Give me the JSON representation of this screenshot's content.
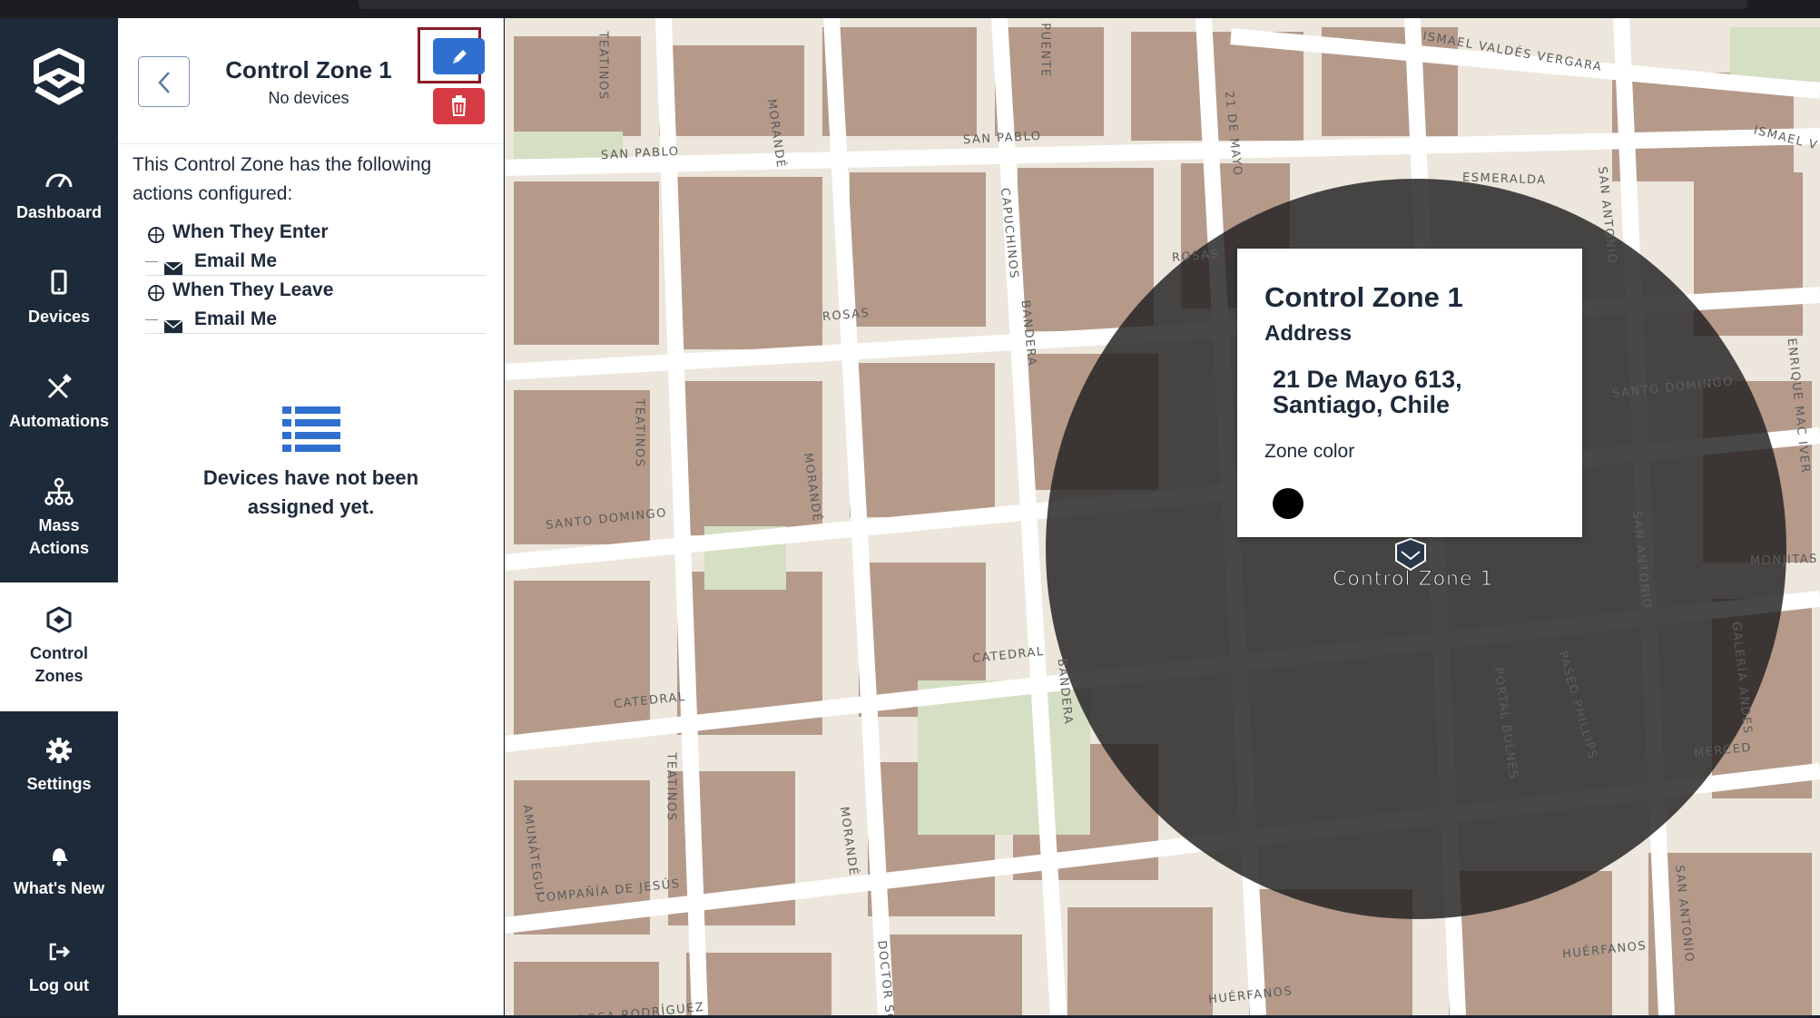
{
  "sidebar": {
    "items": [
      {
        "label": "Dashboard",
        "icon": "gauge-icon"
      },
      {
        "label": "Devices",
        "icon": "device-icon"
      },
      {
        "label": "Automations",
        "icon": "tools-icon"
      },
      {
        "label": "Mass Actions",
        "icon": "hierarchy-icon"
      },
      {
        "label": "Control Zones",
        "icon": "control-zone-icon"
      },
      {
        "label": "Settings",
        "icon": "gear-icon"
      },
      {
        "label": "What's New",
        "icon": "bell-icon"
      },
      {
        "label": "Log out",
        "icon": "logout-icon"
      }
    ],
    "active": "Control Zones"
  },
  "panel": {
    "title": "Control Zone 1",
    "subtitle": "No devices",
    "intro": "This Control Zone has the following actions configured:",
    "tree": [
      {
        "type": "trigger",
        "label": "When They Enter"
      },
      {
        "type": "action",
        "label": "Email Me"
      },
      {
        "type": "trigger",
        "label": "When They Leave"
      },
      {
        "type": "action",
        "label": "Email Me"
      }
    ],
    "empty_message": "Devices have not been assigned yet."
  },
  "popup": {
    "title": "Control Zone 1",
    "address_label": "Address",
    "address": "21 De Mayo 613, Santiago, Chile",
    "color_label": "Zone color",
    "zone_color": "#000000"
  },
  "map": {
    "marker_label": "Control Zone 1",
    "street_labels": [
      "SAN PABLO",
      "SAN PABLO",
      "ROSAS",
      "ROSAS",
      "SANTO DOMINGO",
      "SANTO DOMINGO",
      "CATEDRAL",
      "CATEDRAL",
      "MERCED",
      "COMPAÑÍA DE JESÚS",
      "HUÉRFANOS",
      "HUÉRFANOS",
      "ESMERALDA",
      "TEATINOS",
      "TEATINOS",
      "TEATINOS",
      "MORANDÉ",
      "MORANDÉ",
      "MORANDÉ",
      "BANDERA",
      "BANDERA",
      "CAPUCHINOS",
      "21 DE MAYO",
      "SAN ANTONIO",
      "SAN ANTONIO",
      "SAN ANTONIO",
      "AMUNÁTEGUI",
      "DOCTOR SÓTER",
      "PORTAL BULNES",
      "PASEO PHILLIPS",
      "GALERÍA ANDES",
      "ENRIQUE MAC IVER",
      "MONJITAS",
      "ISMAEL VALDÉS VERGARA",
      "ISMAEL V",
      "ROSA RODRÍGUEZ",
      "PUENTE"
    ]
  },
  "colors": {
    "sidebar_bg": "#1d2a3a",
    "accent_blue": "#2f6fd0",
    "danger_red": "#d63a44",
    "highlight_frame": "#8b1a24",
    "map_bg": "#ece6dc",
    "building": "#b59a8a",
    "zone_overlay": "rgba(32,32,32,0.82)"
  }
}
